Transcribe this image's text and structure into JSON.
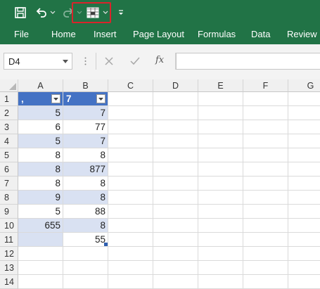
{
  "quick_access": {
    "icons": [
      "save-icon",
      "undo-icon",
      "undo-dropdown-icon",
      "redo-icon",
      "redo-dropdown-icon",
      "table-format-icon",
      "table-format-dropdown-icon",
      "customize-qat-icon"
    ],
    "highlight_color": "#d9242b"
  },
  "ribbon": {
    "tabs": [
      "File",
      "Home",
      "Insert",
      "Page Layout",
      "Formulas",
      "Data",
      "Review"
    ]
  },
  "formula_bar": {
    "name_box": "D4",
    "fx_label": "fx",
    "formula_value": ""
  },
  "sheet": {
    "columns": [
      "A",
      "B",
      "C",
      "D",
      "E",
      "F",
      "G"
    ],
    "rows": [
      "1",
      "2",
      "3",
      "4",
      "5",
      "6",
      "7",
      "8",
      "9",
      "10",
      "11",
      "12",
      "13",
      "14"
    ],
    "table_header": [
      "‚",
      "7"
    ],
    "cells": [
      [
        "5",
        "7"
      ],
      [
        "6",
        "77"
      ],
      [
        "5",
        "7"
      ],
      [
        "8",
        "8"
      ],
      [
        "8",
        "877"
      ],
      [
        "8",
        "8"
      ],
      [
        "9",
        "8"
      ],
      [
        "5",
        "88"
      ],
      [
        "655",
        "8"
      ],
      [
        "",
        "55"
      ]
    ]
  },
  "colors": {
    "ribbon_green": "#217346",
    "table_header_blue": "#4472c4",
    "band_blue": "#d9e1f2"
  }
}
